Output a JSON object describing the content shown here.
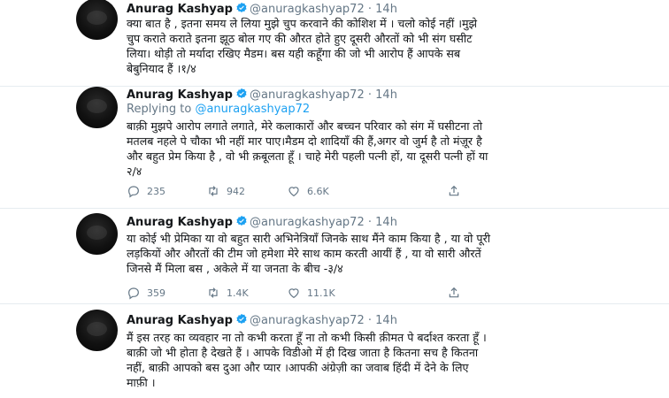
{
  "tweets": [
    {
      "name": "Anurag Kashyap",
      "handle": "@anuragkashyap72",
      "dot": "·",
      "time": "14h",
      "text": "क्या बात है , इतना समय ले लिया मुझे चुप करवाने की कोशिश में । चलो कोई नहीं ।मुझे\nचुप कराते कराते इतना झूठ बोल गए की औरत होते हुए दूसरी औरतों को भी संग घसीट\nलिया। थोड़ी तो मर्यादा रखिए मैडम। बस यही कहूँगा की जो भी आरोप हैं आपके सब\nबेबुनियाद हैं ।१/४"
    },
    {
      "name": "Anurag Kashyap",
      "handle": "@anuragkashyap72",
      "dot": "·",
      "time": "14h",
      "replying_prefix": "Replying to",
      "replying_handle": "@anuragkashyap72",
      "text": "बाक़ी मुझपे आरोप लगाते लगाते, मेरे कलाकारों और बच्चन परिवार को संग में घसीटना तो\nमतलब नहले पे चौका भी नहीं मार पाए।मैडम दो शादियाँ की हैं,अगर वो जुर्म है तो मंज़ूर है\nऔर बहुत प्रेम किया है , वो भी क़बूलता हूँ । चाहे मेरी पहली पत्नी हों, या दूसरी पत्नी हों या\n२/४",
      "replies": "235",
      "retweets": "942",
      "likes": "6.6K"
    },
    {
      "name": "Anurag Kashyap",
      "handle": "@anuragkashyap72",
      "dot": "·",
      "time": "14h",
      "text": "या कोई भी प्रेमिका या वो बहुत सारी अभिनेत्रियाँ जिनके साथ मैंने काम किया है , या वो पूरी\nलड़कियों और औरतों की टीम जो हमेशा मेरे साथ काम करती आयीं हैं , या वो सारी औरतें\nजिनसे मैं मिला बस , अकेले में या जनता के बीच -३/४",
      "replies": "359",
      "retweets": "1.4K",
      "likes": "11.1K"
    },
    {
      "name": "Anurag Kashyap",
      "handle": "@anuragkashyap72",
      "dot": "·",
      "time": "14h",
      "text": "मैं इस तरह का व्यवहार ना तो कभी करता हूँ ना तो कभी किसी क़ीमत पे बर्दाश्त करता हूँ ।\nबाक़ी जो भी होता है देखते हैं । आपके विडीओ में ही दिख जाता है कितना सच है कितना\nनहीं, बाक़ी आपको बस दुआ और प्यार ।आपकी अंग्रेज़ी का जवाब हिंदी में देने के लिए\nमाफ़ी ।"
    }
  ],
  "colors": {
    "text": "#14171a",
    "muted": "#657786",
    "link": "#1da1f2",
    "verified": "#1da1f2",
    "divider": "#e6ecf0"
  },
  "icons": {
    "reply": "speech-bubble-icon",
    "retweet": "retweet-arrows-icon",
    "like": "heart-icon",
    "share": "share-upload-icon",
    "verified": "verified-badge-icon"
  }
}
